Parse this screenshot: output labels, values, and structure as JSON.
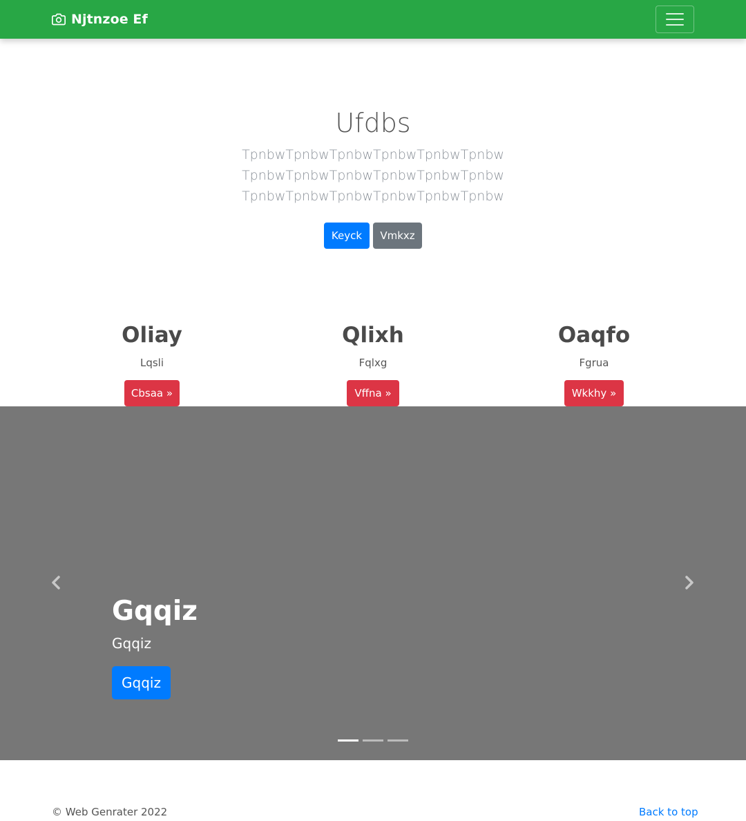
{
  "navbar": {
    "brand": "Njtnzoe Ef",
    "brand_icon": "camera-icon",
    "toggler_icon": "hamburger-icon",
    "background": "#28a745"
  },
  "hero": {
    "title": "Ufdbs",
    "lead_lines": [
      "TpnbwTpnbwTpnbwTpnbwTpnbwTpnbw",
      "TpnbwTpnbwTpnbwTpnbwTpnbwTpnbw",
      "TpnbwTpnbwTpnbwTpnbwTpnbwTpnbw"
    ],
    "primary_button": "Keyck",
    "secondary_button": "Vmkxz"
  },
  "columns": [
    {
      "heading": "Oliay",
      "text": "Lqsli",
      "button": "Cbsaa »"
    },
    {
      "heading": "Qlixh",
      "text": "Fqlxg",
      "button": "Vffna »"
    },
    {
      "heading": "Oaqfo",
      "text": "Fgrua",
      "button": "Wkkhy »"
    }
  ],
  "carousel": {
    "slide_title": "Gqqiz",
    "slide_text": "Gqqiz",
    "slide_button": "Gqqiz",
    "background": "#777777",
    "prev_icon": "chevron-left-icon",
    "next_icon": "chevron-right-icon",
    "slide_count": 3,
    "active_index": 0
  },
  "footer": {
    "copyright": "© Web Genrater 2022",
    "back_to_top": "Back to top"
  },
  "colors": {
    "primary": "#007bff",
    "secondary": "#6c757d",
    "danger": "#dc3545",
    "success": "#28a745"
  }
}
